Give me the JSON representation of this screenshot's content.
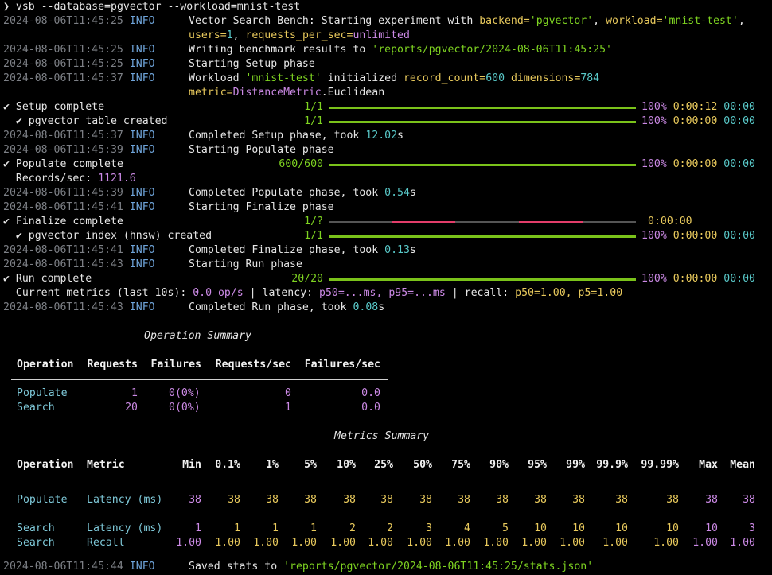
{
  "command": {
    "prompt": "❯",
    "text": "vsb --database=pgvector --workload=mnist-test"
  },
  "log_lines": [
    {
      "ts": "2024-08-06T11:45:25",
      "level": "INFO",
      "msg_a": "Vector Search Bench: Starting experiment with ",
      "k1": "backend=",
      "v1": "'pgvector'",
      "sep1": ", ",
      "k2": "workload=",
      "v2": "'mnist-test'",
      "tail1": ",",
      "k3": "users=",
      "v3": "1",
      "sep3": ", ",
      "k4": "requests_per_sec=",
      "v4": "unlimited"
    },
    {
      "ts": "2024-08-06T11:45:25",
      "level": "INFO",
      "msg": "Writing benchmark results to ",
      "path": "'reports/pgvector/2024-08-06T11:45:25'"
    },
    {
      "ts": "2024-08-06T11:45:25",
      "level": "INFO",
      "msg": "Starting Setup phase"
    },
    {
      "ts": "2024-08-06T11:45:37",
      "level": "INFO",
      "msg": "Workload ",
      "wl": "'mnist-test'",
      "mid": " initialized ",
      "k1": "record_count=",
      "v1": "600",
      "k2": " dimensions=",
      "v2": "784",
      "k3": "metric=",
      "v3": "DistanceMetric",
      "tail": ".Euclidean"
    }
  ],
  "phases": {
    "setup": {
      "check": "✔",
      "label": "Setup complete",
      "count": "1/1",
      "pct": "100%",
      "elapsed": "0:00:12",
      "remain": "00:00"
    },
    "setup_sub": {
      "check": "✔",
      "label": "pgvector table created",
      "count": "1/1",
      "pct": "100%",
      "elapsed": "0:00:00",
      "remain": "00:00"
    },
    "setup_done": {
      "ts": "2024-08-06T11:45:37",
      "level": "INFO",
      "msg": "Completed Setup phase, took ",
      "val": "12.02",
      "unit": "s"
    },
    "populate_start": {
      "ts": "2024-08-06T11:45:39",
      "level": "INFO",
      "msg": "Starting Populate phase"
    },
    "populate": {
      "check": "✔",
      "label": "Populate complete",
      "count": "600/600",
      "pct": "100%",
      "elapsed": "0:00:00",
      "remain": "00:00"
    },
    "records": {
      "label": "Records/sec: ",
      "val": "1121.6"
    },
    "populate_done": {
      "ts": "2024-08-06T11:45:39",
      "level": "INFO",
      "msg": "Completed Populate phase, took ",
      "val": "0.54",
      "unit": "s"
    },
    "finalize_start": {
      "ts": "2024-08-06T11:45:41",
      "level": "INFO",
      "msg": "Starting Finalize phase"
    },
    "finalize": {
      "check": "✔",
      "label": "Finalize complete",
      "count": "1/?",
      "elapsed": "0:00:00"
    },
    "finalize_sub": {
      "check": "✔",
      "label": "pgvector index (hnsw) created",
      "count": "1/1",
      "pct": "100%",
      "elapsed": "0:00:00",
      "remain": "00:00"
    },
    "finalize_done": {
      "ts": "2024-08-06T11:45:41",
      "level": "INFO",
      "msg": "Completed Finalize phase, took ",
      "val": "0.13",
      "unit": "s"
    },
    "run_start": {
      "ts": "2024-08-06T11:45:43",
      "level": "INFO",
      "msg": "Starting Run phase"
    },
    "run": {
      "check": "✔",
      "label": "Run complete",
      "count": "20/20",
      "pct": "100%",
      "elapsed": "0:00:00",
      "remain": "00:00"
    },
    "metrics_line": {
      "a": "Current metrics (last 10s): ",
      "ops": "0.0 op/s",
      "b": " | latency: ",
      "lat": "p50=...ms, p95=...ms",
      "c": " | recall: ",
      "rec": "p50=1.00, p5=1.00"
    },
    "run_done": {
      "ts": "2024-08-06T11:45:43",
      "level": "INFO",
      "msg": "Completed Run phase, took ",
      "val": "0.08",
      "unit": "s"
    }
  },
  "op_summary": {
    "title": "Operation Summary",
    "headers": [
      "Operation",
      "Requests",
      "Failures",
      "Requests/sec",
      "Failures/sec"
    ],
    "rows": [
      [
        "Populate",
        "1",
        "0(0%)",
        "0",
        "0.0"
      ],
      [
        "Search",
        "20",
        "0(0%)",
        "1",
        "0.0"
      ]
    ]
  },
  "metrics_summary": {
    "title": "Metrics Summary",
    "headers": [
      "Operation",
      "Metric",
      "Min",
      "0.1%",
      "1%",
      "5%",
      "10%",
      "25%",
      "50%",
      "75%",
      "90%",
      "95%",
      "99%",
      "99.9%",
      "99.99%",
      "Max",
      "Mean"
    ],
    "rows": [
      [
        "Populate",
        "Latency (ms)",
        "38",
        "38",
        "38",
        "38",
        "38",
        "38",
        "38",
        "38",
        "38",
        "38",
        "38",
        "38",
        "38",
        "38",
        "38"
      ],
      [
        "Search",
        "Latency (ms)",
        "1",
        "1",
        "1",
        "1",
        "2",
        "2",
        "3",
        "4",
        "5",
        "10",
        "10",
        "10",
        "10",
        "10",
        "3"
      ],
      [
        "Search",
        "Recall",
        "1.00",
        "1.00",
        "1.00",
        "1.00",
        "1.00",
        "1.00",
        "1.00",
        "1.00",
        "1.00",
        "1.00",
        "1.00",
        "1.00",
        "1.00",
        "1.00",
        "1.00"
      ]
    ]
  },
  "saved": {
    "ts": "2024-08-06T11:45:44",
    "level": "INFO",
    "msg": "Saved stats to ",
    "path": "'reports/pgvector/2024-08-06T11:45:25/stats.json'"
  },
  "colors": {
    "bar": "#7ac21a",
    "bar_pending": "#e33d6a",
    "info": "#6ea3d8"
  }
}
